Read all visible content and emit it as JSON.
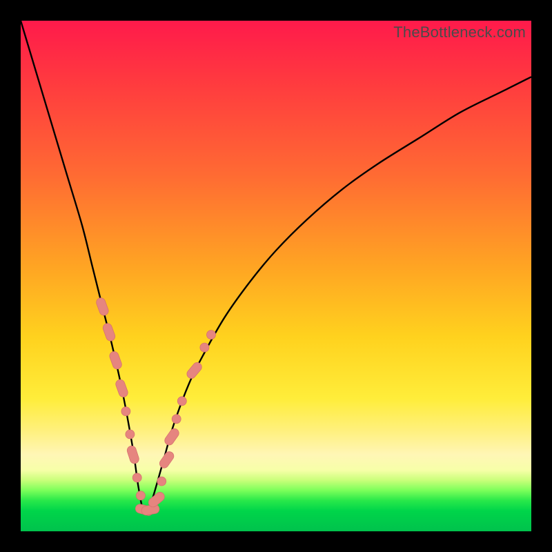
{
  "watermark": "TheBottleneck.com",
  "colors": {
    "frame": "#000000",
    "curve": "#000000",
    "marker_fill": "#e6857f",
    "marker_stroke": "#d6736e"
  },
  "chart_data": {
    "type": "line",
    "title": "",
    "xlabel": "",
    "ylabel": "",
    "xlim": [
      0,
      100
    ],
    "ylim": [
      0,
      100
    ],
    "grid": false,
    "legend": false,
    "note": "Axes are unlabeled in the source image; x/y are normalized 0–100. y represents bottleneck % (0 = no bottleneck / green floor, 100 = top / red). Curve is a V-shaped bottleneck profile with minimum near x≈24.",
    "series": [
      {
        "name": "bottleneck-curve",
        "x": [
          0,
          3,
          6,
          9,
          12,
          14,
          16,
          18,
          20,
          22,
          23,
          24,
          25,
          26,
          28,
          30,
          33,
          36,
          40,
          45,
          50,
          56,
          63,
          70,
          78,
          86,
          94,
          100
        ],
        "y": [
          100,
          90,
          80,
          70,
          60,
          52,
          44,
          36,
          27,
          16,
          9,
          4,
          4,
          7,
          14,
          21,
          29,
          35,
          42,
          49,
          55,
          61,
          67,
          72,
          77,
          82,
          86,
          89
        ]
      }
    ],
    "markers": [
      {
        "x": 16.0,
        "y": 44.0,
        "kind": "capsule",
        "angle": 70
      },
      {
        "x": 17.3,
        "y": 39.0,
        "kind": "capsule",
        "angle": 70
      },
      {
        "x": 18.6,
        "y": 33.5,
        "kind": "capsule",
        "angle": 70
      },
      {
        "x": 19.8,
        "y": 28.0,
        "kind": "capsule",
        "angle": 70
      },
      {
        "x": 20.6,
        "y": 23.5,
        "kind": "dot"
      },
      {
        "x": 21.4,
        "y": 19.0,
        "kind": "dot"
      },
      {
        "x": 22.0,
        "y": 15.0,
        "kind": "capsule",
        "angle": 72
      },
      {
        "x": 22.8,
        "y": 10.5,
        "kind": "dot"
      },
      {
        "x": 23.5,
        "y": 7.0,
        "kind": "dot"
      },
      {
        "x": 24.2,
        "y": 4.2,
        "kind": "capsule",
        "angle": 15
      },
      {
        "x": 25.4,
        "y": 4.2,
        "kind": "capsule",
        "angle": -10
      },
      {
        "x": 26.6,
        "y": 6.2,
        "kind": "capsule",
        "angle": -40
      },
      {
        "x": 27.6,
        "y": 9.8,
        "kind": "dot"
      },
      {
        "x": 28.6,
        "y": 14.0,
        "kind": "capsule",
        "angle": -55
      },
      {
        "x": 29.6,
        "y": 18.5,
        "kind": "capsule",
        "angle": -55
      },
      {
        "x": 30.5,
        "y": 22.0,
        "kind": "dot"
      },
      {
        "x": 31.6,
        "y": 25.5,
        "kind": "dot"
      },
      {
        "x": 34.0,
        "y": 31.5,
        "kind": "capsule",
        "angle": -50
      },
      {
        "x": 36.0,
        "y": 36.0,
        "kind": "dot"
      },
      {
        "x": 37.3,
        "y": 38.5,
        "kind": "dot"
      }
    ]
  }
}
